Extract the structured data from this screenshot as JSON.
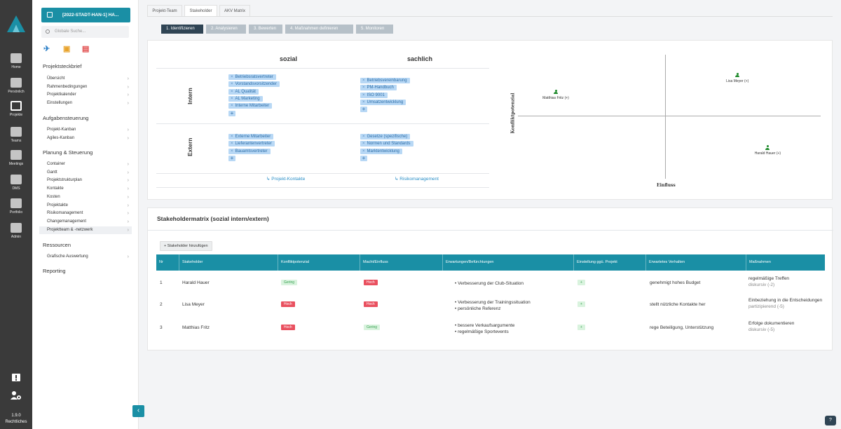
{
  "rail": {
    "items": [
      {
        "label": "Home",
        "icon": "home-icon"
      },
      {
        "label": "Persönlich",
        "icon": "person-icon"
      },
      {
        "label": "Projekte",
        "icon": "projects-icon"
      },
      {
        "label": "Teams",
        "icon": "teams-icon"
      },
      {
        "label": "Meetings",
        "icon": "meetings-icon"
      },
      {
        "label": "DMS",
        "icon": "folder-icon"
      },
      {
        "label": "Portfolio",
        "icon": "portfolio-icon"
      },
      {
        "label": "Admin",
        "icon": "admin-icon"
      }
    ],
    "version": "1.9.0",
    "legal": "Rechtliches"
  },
  "nav": {
    "project_button": "[2022-STADT-HAN-1] HA...",
    "search_placeholder": "Globale Suche...",
    "sections": [
      {
        "title": "Projektsteckbrief",
        "items": [
          "Übersicht",
          "Rahmenbedingungen",
          "Projektkalender",
          "Einstellungen"
        ]
      },
      {
        "title": "Aufgabensteuerung",
        "items": [
          "Projekt-Kanban",
          "Agiles-Kanban"
        ]
      },
      {
        "title": "Planung & Steuerung",
        "items": [
          "Container",
          "Gantt",
          "Projektstrukturplan",
          "Kontakte",
          "Kosten",
          "Projektakte",
          "Risikomanagement",
          "Changemanagement",
          "Projektteam & -netzwerk"
        ]
      },
      {
        "title": "Ressourcen",
        "items": [
          "Grafische Auswertung"
        ]
      },
      {
        "title": "Reporting",
        "items": []
      }
    ]
  },
  "tabs": [
    "Projekt-Team",
    "Stakeholder",
    "AKV Matrix"
  ],
  "steps": [
    "1. Identifizieren",
    "2. Analysieren",
    "3. Bewerten",
    "4. Maßnahmen definieren",
    "5. Monitoren"
  ],
  "matrix": {
    "col_sozial": "sozial",
    "col_sachlich": "sachlich",
    "row_intern": "Intern",
    "row_extern": "Extern",
    "intern_sozial": [
      "Betriebsratsvertreter",
      "Vorstandsvorsitzender",
      "AL Qualität",
      "AL Marketing",
      "Interne Mitarbeiter"
    ],
    "intern_sachlich": [
      "Betriebsvereinbarung",
      "PM-Handbuch",
      "ISO 9001",
      "Umsatzentwicklung"
    ],
    "extern_sozial": [
      "Externe Mitarbeiter",
      "Lieferantenvertreter",
      "Bauamtsvertreter"
    ],
    "extern_sachlich": [
      "Gesetze (spezifische)",
      "Normen und Standards",
      "Marktentwicklung"
    ],
    "link_contacts": "Projekt-Kontakte",
    "link_risk": "Risikomanagement",
    "plus": "+",
    "remove": "×"
  },
  "chart_data": {
    "type": "scatter",
    "xlabel": "Einfluss",
    "ylabel": "Konfliktpotenzial",
    "points": [
      {
        "label": "Matthias Fritz (+)",
        "x": -0.75,
        "y": 0.35
      },
      {
        "label": "Lisa Meyer (+)",
        "x": 0.45,
        "y": 0.62
      },
      {
        "label": "Harald Hauer (+)",
        "x": 0.65,
        "y": -0.55
      }
    ],
    "xlim": [
      -1,
      1
    ],
    "ylim": [
      -1,
      1
    ]
  },
  "table": {
    "title": "Stakeholdermatrix (sozial intern/extern)",
    "add_button": "Stakeholder hinzufügen",
    "headers": [
      "Nr",
      "Stakeholder",
      "Konfliktpotenzial",
      "Macht/Einfluss",
      "Erwartungen/Befürchtungen",
      "Einstellung ggü. Projekt",
      "Erwartetes Verhalten",
      "Maßnahmen"
    ],
    "rows": [
      {
        "nr": "1",
        "name": "Harald Hauer",
        "konflikt": "Gering",
        "macht": "Hoch",
        "erwartungen": [
          "Verbesserung der Club-Situation"
        ],
        "einstellung": "+",
        "verhalten": "genehmigt hohes Budget",
        "massnahme": "regelmäßige Treffen",
        "massnahme_sub": "diskursiv (-2)"
      },
      {
        "nr": "2",
        "name": "Lisa Meyer",
        "konflikt": "Hoch",
        "macht": "Hoch",
        "erwartungen": [
          "Verbesserung der Trainingssituation",
          "persönliche Referenz"
        ],
        "einstellung": "+",
        "verhalten": "stellt nützliche Kontakte her",
        "massnahme": "Einbeziehung in die Entscheidungen",
        "massnahme_sub": "partizipierend (-5)"
      },
      {
        "nr": "3",
        "name": "Matthias Fritz",
        "konflikt": "Hoch",
        "macht": "Gering",
        "erwartungen": [
          "bessere Verkaufsargumente",
          "regelmäßige Sportevents"
        ],
        "einstellung": "+",
        "verhalten": "rege Beteiligung, Unterstützung",
        "massnahme": "Erfolge dokumentieren",
        "massnahme_sub": "diskursiv (-5)"
      }
    ]
  },
  "help": "?",
  "colors": {
    "accent": "#1a8fa5",
    "rail": "#3a3a3a",
    "step_active": "#2f4454",
    "chip": "#b8d8f5",
    "high": "#e9505f",
    "low": "#d9f3de"
  }
}
